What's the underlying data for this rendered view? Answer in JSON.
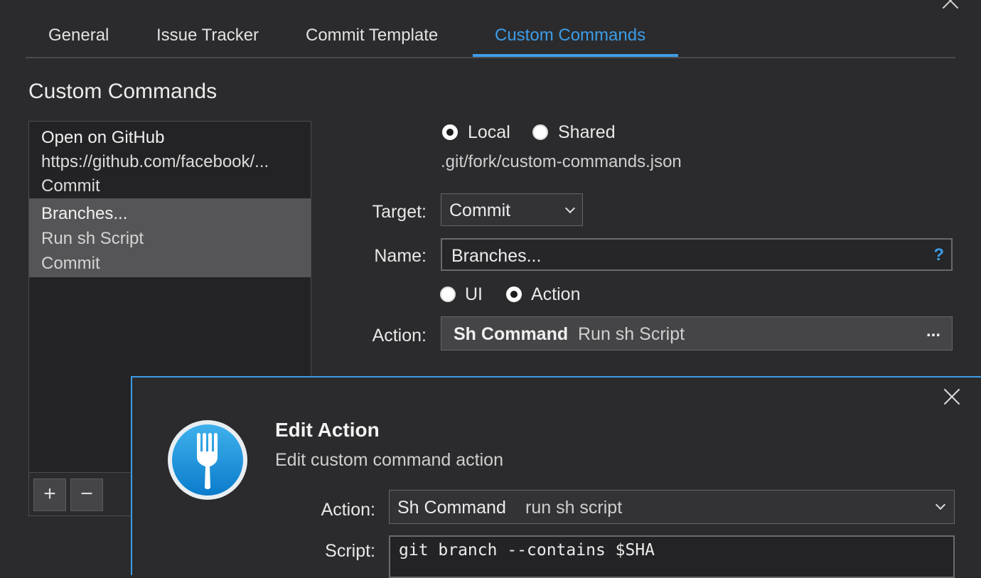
{
  "tabs": [
    {
      "label": "General"
    },
    {
      "label": "Issue Tracker"
    },
    {
      "label": "Commit Template"
    },
    {
      "label": "Custom Commands"
    }
  ],
  "active_tab": "Custom Commands",
  "section_title": "Custom Commands",
  "commands": [
    {
      "name": "Open on GitHub",
      "action": "https://github.com/facebook/...",
      "target": "Commit"
    },
    {
      "name": "Branches...",
      "action": "Run sh Script",
      "target": "Commit"
    }
  ],
  "list_buttons": {
    "add": "+",
    "remove": "−"
  },
  "scope": {
    "local_label": "Local",
    "shared_label": "Shared",
    "selected": "Local"
  },
  "config_path": ".git/fork/custom-commands.json",
  "form": {
    "target_label": "Target:",
    "target_value": "Commit",
    "name_label": "Name:",
    "name_value": "Branches...",
    "name_help": "?",
    "type_ui_label": "UI",
    "type_action_label": "Action",
    "type_selected": "Action",
    "action_label": "Action:",
    "action_kind": "Sh Command",
    "action_desc": "Run sh Script",
    "action_more": "..."
  },
  "dialog": {
    "title": "Edit Action",
    "subtitle": "Edit custom command action",
    "action_label": "Action:",
    "action_kind": "Sh Command",
    "action_desc": "run sh script",
    "script_label": "Script:",
    "script_value": "git branch --contains $SHA"
  },
  "colors": {
    "accent": "#3d9ce8",
    "background": "#2b2b2d",
    "selected_row": "#555557"
  }
}
